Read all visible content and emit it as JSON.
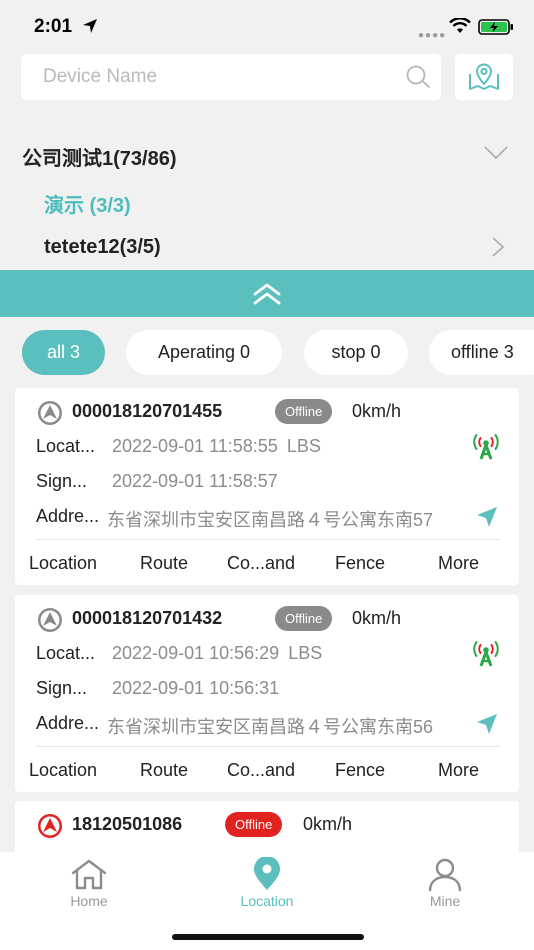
{
  "status": {
    "time": "2:01"
  },
  "search": {
    "placeholder": "Device Name"
  },
  "group": {
    "name": "公司测试1(73/86)",
    "children": [
      {
        "label": "演示 (3/3)"
      },
      {
        "label": "tetete12(3/5)"
      }
    ]
  },
  "filters": [
    {
      "label": "all 3"
    },
    {
      "label": "Aperating 0"
    },
    {
      "label": "stop 0"
    },
    {
      "label": "offline 3"
    }
  ],
  "labels": {
    "location": "Locat...",
    "signal": "Sign...",
    "address": "Addre..."
  },
  "actions": [
    "Location",
    "Route",
    "Co...and",
    "Fence",
    "More"
  ],
  "devices": [
    {
      "id": "000018120701455",
      "status": "Offline",
      "speed": "0km/h",
      "location_time": "2022-09-01 11:58:55",
      "location_type": "LBS",
      "signal_time": "2022-09-01 11:58:57",
      "address": "东省深圳市宝安区南昌路４号公寓东南57"
    },
    {
      "id": "000018120701432",
      "status": "Offline",
      "speed": "0km/h",
      "location_time": "2022-09-01 10:56:29",
      "location_type": "LBS",
      "signal_time": "2022-09-01 10:56:31",
      "address": "东省深圳市宝安区南昌路４号公寓东南56"
    },
    {
      "id": "18120501086",
      "status": "Offline",
      "speed": "0km/h"
    }
  ],
  "tabs": [
    {
      "label": "Home"
    },
    {
      "label": "Location"
    },
    {
      "label": "Mine"
    }
  ],
  "colors": {
    "accent": "#5bbfbe",
    "offline_gray": "#8a8a8a",
    "offline_red": "#e0231f",
    "signal_green": "#2aa84a"
  }
}
